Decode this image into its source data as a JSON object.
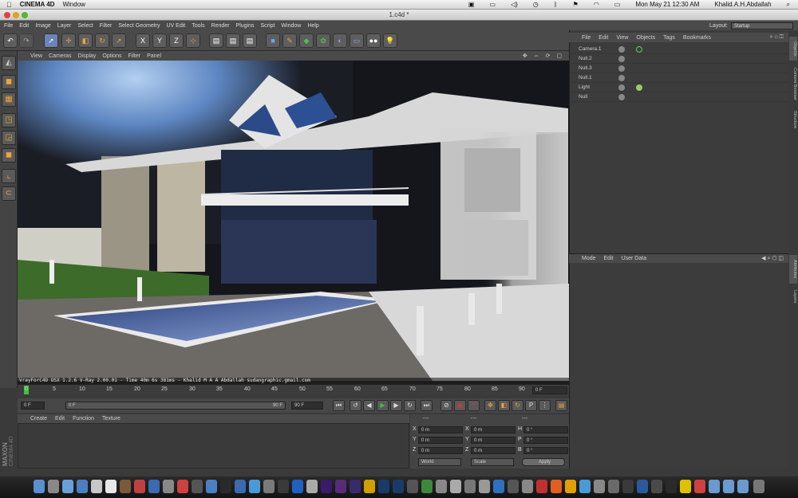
{
  "mac_menubar": {
    "app_name": "CINEMA 4D",
    "window_menu": "Window",
    "datetime": "Mon May 21  12:30 AM",
    "user": "Khalid.A.H.Abdallah"
  },
  "window": {
    "title": "1.c4d *"
  },
  "menu": {
    "items": [
      "File",
      "Edit",
      "Image",
      "Layer",
      "Select",
      "Filter",
      "Select Geometry",
      "UV Edit",
      "Tools",
      "Render",
      "Plugins",
      "Script",
      "Window",
      "Help"
    ],
    "layout_label": "Layout:",
    "layout_value": "Startup"
  },
  "viewport_menu": {
    "items": [
      "View",
      "Cameras",
      "Display",
      "Options",
      "Filter",
      "Panel"
    ]
  },
  "render_status": "VrayForC4D OSX 1.2.6 V-Ray 2.00.01 - Time 40m 6s 381ms - Khalid M A A Abdallah sudangraphic.gmail.com",
  "timeline": {
    "ticks": [
      "0",
      "5",
      "10",
      "15",
      "20",
      "25",
      "30",
      "35",
      "40",
      "45",
      "50",
      "55",
      "60",
      "65",
      "70",
      "75",
      "80",
      "85",
      "90"
    ],
    "current_frame": "0 F"
  },
  "transport": {
    "start_field": "0 F",
    "current_field": "0 F",
    "end_field": "90 F",
    "end_field2": "90 F"
  },
  "material_menu": {
    "items": [
      "Create",
      "Edit",
      "Function",
      "Texture"
    ]
  },
  "coords": {
    "headers": [
      "---",
      "---",
      "---"
    ],
    "rows": [
      {
        "a": "X",
        "av": "0 m",
        "b": "X",
        "bv": "0 m",
        "c": "H",
        "cv": "0 °"
      },
      {
        "a": "Y",
        "av": "0 m",
        "b": "Y",
        "bv": "0 m",
        "c": "P",
        "cv": "0 °"
      },
      {
        "a": "Z",
        "av": "0 m",
        "b": "Z",
        "bv": "0 m",
        "c": "B",
        "cv": "0 °"
      }
    ],
    "world": "World",
    "scale": "Scale",
    "apply": "Apply"
  },
  "object_manager": {
    "menu": [
      "File",
      "Edit",
      "View",
      "Objects",
      "Tags",
      "Bookmarks"
    ],
    "objects": [
      "Camera.1",
      "Null.2",
      "Null.3",
      "Null.1",
      "Light",
      "Null"
    ]
  },
  "attribute_manager": {
    "menu": [
      "Mode",
      "Edit",
      "User Data"
    ]
  },
  "side_tabs": [
    "Objects",
    "Content Browser",
    "Structure",
    "Attributes",
    "Layers"
  ],
  "logo": {
    "brand": "MAXON",
    "product": "CINEMA 4D"
  },
  "colors": {
    "accent_orange": "#f0a23a",
    "panel_dark": "#3a3a3a",
    "play_green": "#3fbf3f",
    "record_red": "#d33"
  }
}
